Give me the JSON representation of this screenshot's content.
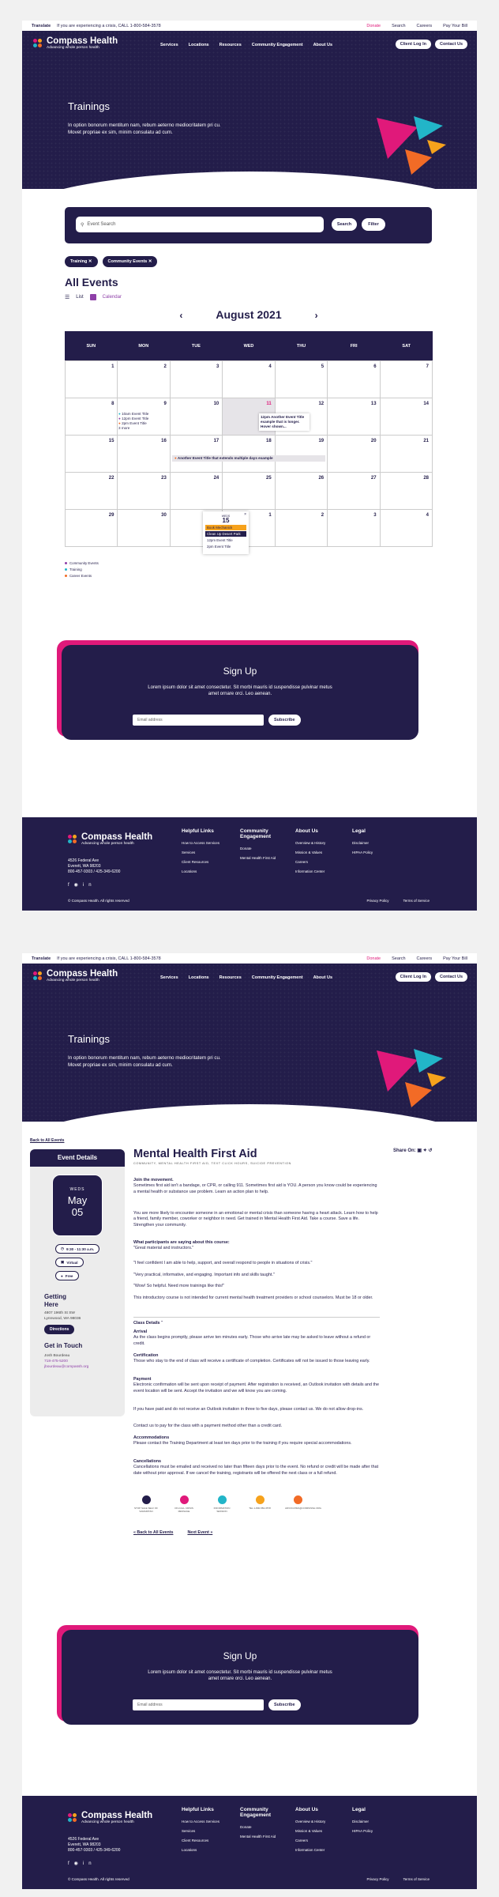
{
  "topbar": {
    "translate": "Translate",
    "crisis": "If you are experiencing a crisis, CALL 1-800-584-3578",
    "donate": "Donate",
    "search": "Search",
    "careers": "Careers",
    "pay": "Pay Your Bill"
  },
  "brand": {
    "name": "Compass Health",
    "tagline": "Advancing whole person health"
  },
  "nav": {
    "items": [
      "Services",
      "Locations",
      "Resources",
      "Community Engagement",
      "About Us"
    ],
    "client_login": "Client Log In",
    "contact": "Contact Us"
  },
  "hero": {
    "title": "Trainings",
    "text": "In option bonorum mentitum nam, rebum aeterno mediocritatem pri cu. Movet propriae ex sim, minim consulatu ad cum."
  },
  "search": {
    "placeholder": "Event Search",
    "search_btn": "Search",
    "filter_btn": "Filter"
  },
  "chips": [
    "Training ✕",
    "Community Events ✕"
  ],
  "events": {
    "heading": "All Events",
    "list": "List",
    "calendar": "Calendar",
    "month": "August 2021"
  },
  "calendar": {
    "days": [
      "SUN",
      "MON",
      "TUE",
      "WED",
      "THU",
      "FRI",
      "SAT"
    ],
    "dates": [
      "",
      "",
      "",
      "",
      "",
      "",
      "",
      "1",
      "2",
      "3",
      "4",
      "5",
      "6",
      "7",
      "8",
      "9",
      "10",
      "11",
      "12",
      "13",
      "14",
      "15",
      "16",
      "17",
      "18",
      "19",
      "20",
      "21",
      "22",
      "23",
      "24",
      "25",
      "26",
      "27",
      "28",
      "29",
      "30",
      "31",
      "1",
      "2",
      "3",
      "4"
    ],
    "ev9": [
      "10am Event Title",
      "12pm Event Title",
      "2pm Event Title",
      "3 more"
    ],
    "ev12": "12pm Another Event Title example that is longer. Hover shown...",
    "ev17": "Another Event Title that extends multiple days example",
    "popup": {
      "weekday": "WEDS",
      "day": "15",
      "rows": [
        "Book Mechanick",
        "Clean Up Desert Park",
        "12pm Event Title",
        "2pm Event Title"
      ]
    }
  },
  "legend": [
    "Community Events",
    "Training",
    "Career Events"
  ],
  "signup": {
    "title": "Sign Up",
    "text": "Lorem ipsum dolor sit amet consectetur. Sit morbi mauris id suspendisse pulvinar metus amet ornare orci. Leo aenean.",
    "email_placeholder": "Email address",
    "subscribe": "Subscribe"
  },
  "footer": {
    "address": [
      "4526 Federal Ave",
      "Everett, WA 98203",
      "800-457-9303 / 425-349-6200"
    ],
    "copyright": "© Compass Health. All rights reserved",
    "cols": [
      {
        "title": "Helpful Links",
        "items": [
          "How to Access Services",
          "Services",
          "Client Resources",
          "Locations"
        ]
      },
      {
        "title": "Community Engagement",
        "items": [
          "Donate",
          "Mental Health First Aid"
        ]
      },
      {
        "title": "About Us",
        "items": [
          "Overview & History",
          "Mission & Values",
          "Careers",
          "Information Center"
        ]
      },
      {
        "title": "Legal",
        "items": [
          "Disclaimer",
          "HIPAA Policy"
        ]
      }
    ],
    "privacy": "Privacy Policy",
    "terms": "Terms of Service"
  },
  "detail": {
    "back": "Back to All Events",
    "sidebar_title": "Event Details",
    "weekday": "WEDS",
    "month": "May",
    "day": "05",
    "time": "9:30 - 11:30 a.m.",
    "virtual": "Virtual",
    "free": "Free",
    "getting_here": "Getting Here",
    "address": [
      "4807 196th St SW",
      "Lynnwood, WA 98036"
    ],
    "directions": "Directions",
    "get_in_touch": "Get in Touch",
    "contact": [
      "Josh Bourdeau",
      "718-475-5200",
      "jbourdeau@compassh.org"
    ],
    "title": "Mental Health First Aid",
    "categories": "COMMUNITY, MENTAL HEALTH FIRST AID, TEXT CLICK HOURS, SUICIDE PREVENTION",
    "share": "Share On:",
    "p1_title": "Join the movement.",
    "p1": "Sometimes first aid isn't a bandage, or CPR, or calling 911. Sometimes first aid is YOU. A person you know could be experiencing a mental health or substance use problem. Learn an action plan to help.",
    "p2": "You are more likely to encounter someone in an emotional or mental crisis than someone having a heart attack. Learn how to help a friend, family member, coworker or neighbor in need. Get trained in Mental Health First Aid. Take a course. Save a life. Strengthen your community.",
    "p3_title": "What participants are saying about this course:",
    "q1": "\"Great material and instructors.\"",
    "q2": "\"I feel confident I am able to help, support, and overall respond to people in situations of crisis.\"",
    "q3": "\"Very practical, informative, and engaging. Important info and skills taught.\"",
    "q4": "\"Wow! So helpful. Need more trainings like this!\"",
    "p4": "This introductory course is not intended for current mental health treatment providers or school counselors. Must be 18 or older.",
    "class_details": "Class Details",
    "arrival_t": "Arrival",
    "arrival": "As the class begins promptly, please arrive ten minutes early. Those who arrive late may be asked to leave without a refund or credit.",
    "cert_t": "Certification",
    "cert": "Those who stay to the end of class will receive a certificate of completion. Certificates will not be issued to those leaving early.",
    "pay_t": "Payment",
    "pay": "Electronic confirmation will be sent upon receipt of payment. After registration is received, an Outlook invitation with details and the event location will be sent. Accept the invitation and we will know you are coming.",
    "pay2": "If you have paid and do not receive an Outlook invitation in three to five days, please contact us. We do not allow drop-ins.",
    "pay3": "Contact us to pay for the class with a payment method other than a credit card.",
    "acc_t": "Accommodations",
    "acc": "Please contact the Training Department at least ten days prior to the training if you require special accommodations.",
    "canc_t": "Cancellations",
    "canc": "Cancellations must be emailed and received no later than fifteen days prior to the event. No refund or credit will be made after that date without prior approval. If we cancel the training, registrants will be offered the next class or a full refund.",
    "icon_labels": [
      "STOP SALE SELF OF SAMARITAN",
      "ON-CALL CRISIS MESSAGE",
      "INFORMATION SESSION",
      "TEL 1-800-584-3578",
      "ADVOCATES@COMPASSH.ORG"
    ],
    "back_link": "Back to All Events",
    "next_link": "Next Event"
  }
}
